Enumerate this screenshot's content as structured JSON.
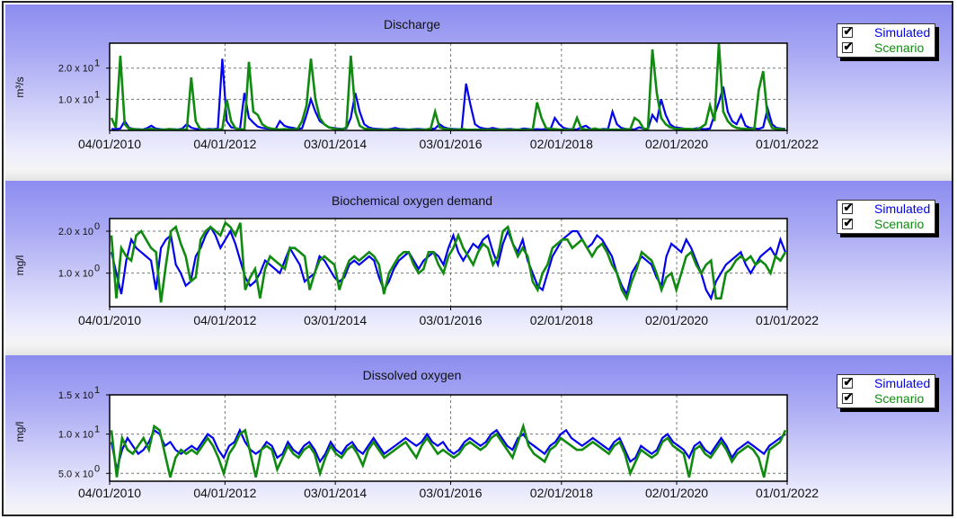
{
  "colors": {
    "simulated": "#0000ee",
    "scenario": "#108a10"
  },
  "legend": {
    "simulated_label": "Simulated",
    "scenario_label": "Scenario",
    "checked_glyph": "✔"
  },
  "chart_data": [
    {
      "type": "line",
      "title": "Discharge",
      "ylabel": "m³/s",
      "xlabel": "",
      "x_tick_labels": [
        "04/01/2010",
        "04/01/2012",
        "03/01/2014",
        "03/01/2016",
        "02/01/2018",
        "02/01/2020",
        "01/01/2022"
      ],
      "x_range": [
        "04/01/2010",
        "01/01/2022"
      ],
      "ylim": [
        0,
        28
      ],
      "y_ticks": [
        {
          "value": 20,
          "mantissa": "2.0",
          "exponent": "1"
        },
        {
          "value": 10,
          "mantissa": "1.0",
          "exponent": "1"
        }
      ],
      "grid": true,
      "series": [
        {
          "name": "Simulated",
          "values": [
            0.5,
            0.4,
            0.6,
            3,
            0.8,
            0.5,
            0.4,
            0.3,
            0.7,
            1.5,
            0.6,
            0.4,
            0.3,
            0.5,
            0.4,
            0.3,
            0.6,
            2,
            0.9,
            0.5,
            0.4,
            0.3,
            0.5,
            0.4,
            0.6,
            23,
            3,
            1,
            0.7,
            0.5,
            12,
            4,
            2.5,
            1.2,
            0.8,
            0.6,
            0.5,
            0.4,
            3,
            1.5,
            1,
            0.8,
            0.5,
            0.7,
            5,
            10,
            6,
            3,
            2,
            1,
            0.8,
            0.6,
            0.5,
            0.7,
            4,
            12,
            6,
            2,
            1,
            0.6,
            0.5,
            0.4,
            0.3,
            0.5,
            0.8,
            0.5,
            0.4,
            0.3,
            0.4,
            0.5,
            0.4,
            0.3,
            0.4,
            0.6,
            2,
            1,
            0.6,
            0.5,
            0.4,
            0.3,
            15,
            8,
            2,
            1,
            0.6,
            0.5,
            0.8,
            0.5,
            0.3,
            0.4,
            0.5,
            0.3,
            0.3,
            0.6,
            0.5,
            0.3,
            0.4,
            0.3,
            0.5,
            0.3,
            4,
            2,
            0.8,
            0.5,
            0.4,
            0.3,
            1,
            1.5,
            0.5,
            0.3,
            0.3,
            0.5,
            0.4,
            6,
            2,
            0.8,
            0.5,
            0.4,
            0.3,
            1,
            0.6,
            0.4,
            5,
            3,
            10,
            5,
            2,
            1,
            0.8,
            0.6,
            0.5,
            0.4,
            0.7,
            0.5,
            0.4,
            0.6,
            5,
            9,
            14,
            6,
            3,
            2,
            5,
            1.5,
            0.8,
            0.6,
            0.5,
            1,
            7,
            2,
            0.8,
            0.6,
            0.5
          ]
        },
        {
          "name": "Scenario",
          "values": [
            4,
            0.8,
            24,
            2,
            0.5,
            0.4,
            0.3,
            0.2,
            0.3,
            0.5,
            0.3,
            0.2,
            0.3,
            0.4,
            0.3,
            0.2,
            0.3,
            0.3,
            17,
            3,
            0.5,
            0.3,
            0.2,
            0.3,
            0.3,
            0.4,
            10,
            3,
            0.6,
            0.4,
            0.3,
            22,
            6,
            5,
            2,
            1,
            0.6,
            0.4,
            0.3,
            0.4,
            0.3,
            0.3,
            0.5,
            3,
            8,
            23,
            10,
            4,
            2,
            1,
            0.6,
            0.4,
            0.3,
            1,
            24,
            6,
            1.5,
            0.6,
            0.4,
            0.3,
            0.2,
            0.2,
            0.3,
            0.2,
            0.3,
            0.2,
            0.2,
            0.2,
            0.3,
            0.2,
            0.2,
            0.3,
            0.6,
            6,
            1,
            0.5,
            0.4,
            0.3,
            0.2,
            0.5,
            0.3,
            0.2,
            0.3,
            0.2,
            0.2,
            0.3,
            0.2,
            0.2,
            0.3,
            0.2,
            0.2,
            0.3,
            0.2,
            0.2,
            0.3,
            0.2,
            9,
            4,
            0.8,
            0.5,
            0.4,
            0.3,
            0.2,
            0.3,
            0.2,
            4,
            0.6,
            0.3,
            0.2,
            0.6,
            0.3,
            0.2,
            0.3,
            0.3,
            0.3,
            0.2,
            0.4,
            0.3,
            4,
            3,
            0.6,
            0.4,
            26,
            12,
            4,
            2,
            1,
            0.6,
            0.4,
            0.5,
            0.5,
            0.4,
            0.3,
            1,
            2,
            8,
            3,
            28,
            6,
            3,
            1.5,
            0.8,
            0.6,
            0.5,
            0.4,
            0.6,
            13,
            19,
            4,
            0.8,
            0.5,
            0.4,
            0.3
          ]
        }
      ]
    },
    {
      "type": "line",
      "title": "Biochemical oxygen demand",
      "ylabel": "mg/l",
      "xlabel": "",
      "x_tick_labels": [
        "04/01/2010",
        "04/01/2012",
        "03/01/2014",
        "03/01/2016",
        "02/01/2018",
        "02/01/2020",
        "01/01/2022"
      ],
      "x_range": [
        "04/01/2010",
        "01/01/2022"
      ],
      "ylim": [
        0.2,
        2.3
      ],
      "y_ticks": [
        {
          "value": 2.0,
          "mantissa": "2.0",
          "exponent": "0"
        },
        {
          "value": 1.0,
          "mantissa": "1.0",
          "exponent": "0"
        }
      ],
      "grid": true,
      "series": [
        {
          "name": "Simulated",
          "values": [
            1.5,
            1.0,
            0.5,
            1.3,
            1.8,
            1.6,
            1.5,
            1.4,
            1.3,
            0.6,
            1.6,
            1.8,
            1.9,
            1.2,
            1.0,
            0.7,
            0.8,
            1.4,
            1.6,
            1.9,
            2.1,
            1.9,
            1.6,
            1.8,
            2.0,
            1.7,
            1.3,
            0.9,
            0.7,
            0.8,
            1.0,
            1.3,
            1.2,
            1.1,
            1.0,
            1.3,
            1.6,
            1.4,
            1.2,
            0.8,
            0.9,
            1.0,
            1.4,
            1.3,
            1.1,
            0.9,
            0.8,
            0.9,
            1.2,
            1.3,
            1.2,
            1.3,
            1.4,
            1.3,
            0.9,
            0.6,
            0.8,
            1.1,
            1.3,
            1.4,
            1.5,
            1.3,
            1.1,
            1.3,
            1.4,
            1.5,
            1.4,
            1.2,
            1.6,
            1.9,
            1.5,
            1.3,
            1.5,
            1.7,
            1.6,
            1.8,
            1.9,
            1.5,
            1.2,
            1.7,
            2.0,
            1.7,
            1.5,
            1.8,
            1.3,
            1.0,
            0.7,
            0.6,
            1.0,
            1.4,
            1.6,
            1.8,
            1.9,
            2.0,
            2.0,
            1.8,
            1.6,
            1.7,
            1.9,
            1.8,
            1.6,
            1.4,
            1.0,
            0.7,
            0.5,
            1.0,
            1.2,
            1.4,
            1.3,
            1.2,
            0.9,
            0.7,
            1.4,
            1.7,
            1.6,
            1.5,
            1.8,
            1.6,
            1.3,
            1.0,
            0.6,
            0.4,
            0.8,
            1.0,
            1.2,
            1.3,
            1.4,
            1.5,
            1.2,
            1.0,
            1.2,
            1.4,
            1.5,
            1.6,
            1.4,
            1.8,
            1.5
          ]
        },
        {
          "name": "Scenario",
          "values": [
            1.9,
            0.4,
            1.6,
            1.4,
            1.3,
            1.9,
            2.0,
            1.8,
            1.6,
            1.5,
            0.3,
            1.2,
            2.0,
            2.1,
            1.7,
            1.4,
            0.8,
            0.9,
            1.8,
            2.0,
            2.1,
            2.0,
            1.9,
            2.2,
            2.1,
            1.9,
            2.2,
            0.6,
            0.9,
            1.1,
            0.4,
            1.1,
            1.4,
            1.3,
            1.2,
            1.1,
            1.6,
            1.6,
            1.5,
            1.4,
            0.6,
            1.0,
            1.3,
            1.4,
            1.3,
            1.2,
            0.6,
            1.0,
            1.3,
            1.4,
            1.3,
            1.4,
            1.5,
            1.4,
            1.2,
            0.5,
            1.0,
            1.2,
            1.4,
            1.5,
            1.5,
            1.2,
            1.0,
            1.1,
            1.5,
            1.5,
            1.2,
            1.0,
            1.4,
            1.6,
            1.9,
            1.6,
            1.4,
            1.2,
            1.5,
            1.7,
            1.6,
            1.2,
            1.4,
            2.0,
            2.1,
            1.7,
            1.4,
            1.6,
            1.4,
            0.8,
            0.6,
            1.0,
            1.2,
            1.6,
            1.7,
            1.8,
            1.8,
            1.6,
            1.7,
            1.8,
            1.6,
            1.4,
            1.6,
            1.7,
            1.5,
            1.2,
            1.0,
            0.6,
            0.4,
            0.8,
            1.1,
            1.5,
            1.4,
            1.3,
            1.0,
            0.6,
            0.9,
            1.0,
            0.6,
            1.0,
            1.4,
            1.5,
            1.2,
            1.0,
            1.2,
            1.3,
            0.4,
            0.4,
            1.0,
            1.1,
            1.3,
            1.4,
            1.3,
            1.4,
            1.2,
            1.3,
            1.2,
            1.0,
            1.4,
            1.3,
            1.5
          ]
        }
      ]
    },
    {
      "type": "line",
      "title": "Dissolved oxygen",
      "ylabel": "mg/l",
      "xlabel": "",
      "x_tick_labels": [
        "04/01/2010",
        "04/01/2012",
        "03/01/2014",
        "03/01/2016",
        "02/01/2018",
        "02/01/2020",
        "01/01/2022"
      ],
      "x_range": [
        "04/01/2010",
        "01/01/2022"
      ],
      "ylim": [
        4.0,
        15.0
      ],
      "y_ticks": [
        {
          "value": 15,
          "mantissa": "1.5",
          "exponent": "1"
        },
        {
          "value": 10,
          "mantissa": "1.0",
          "exponent": "1"
        },
        {
          "value": 5,
          "mantissa": "5.0",
          "exponent": "0"
        }
      ],
      "grid": true,
      "series": [
        {
          "name": "Simulated",
          "values": [
            9.0,
            5.5,
            8.0,
            9.5,
            8.5,
            7.5,
            8.0,
            9.0,
            10.5,
            10.0,
            8.5,
            9.0,
            8.0,
            7.5,
            8.0,
            8.5,
            8.0,
            9.0,
            10.0,
            9.5,
            8.0,
            7.0,
            8.5,
            9.0,
            10.5,
            9.0,
            8.0,
            7.5,
            8.0,
            9.0,
            8.5,
            7.0,
            7.5,
            9.0,
            8.0,
            7.5,
            8.5,
            9.0,
            8.0,
            6.5,
            7.5,
            9.0,
            8.0,
            7.5,
            8.5,
            9.0,
            8.0,
            7.5,
            8.5,
            9.5,
            8.5,
            7.5,
            8.0,
            8.5,
            9.0,
            9.5,
            9.0,
            8.5,
            9.0,
            10.0,
            9.0,
            8.5,
            9.0,
            8.0,
            7.5,
            8.0,
            9.0,
            9.5,
            9.0,
            8.5,
            9.0,
            10.0,
            10.5,
            9.5,
            8.5,
            8.0,
            9.5,
            10.0,
            9.0,
            8.5,
            8.0,
            7.5,
            8.5,
            9.0,
            10.0,
            10.5,
            9.5,
            9.0,
            8.5,
            9.0,
            9.5,
            9.0,
            8.5,
            8.0,
            9.0,
            9.5,
            8.0,
            6.5,
            7.0,
            8.5,
            8.0,
            7.5,
            8.0,
            9.5,
            10.0,
            9.0,
            8.5,
            8.0,
            7.0,
            8.5,
            9.0,
            8.0,
            7.5,
            8.5,
            9.5,
            8.5,
            7.0,
            8.0,
            8.5,
            9.0,
            8.5,
            8.0,
            7.5,
            8.5,
            9.0,
            9.5,
            10.0
          ]
        },
        {
          "name": "Scenario",
          "values": [
            10.5,
            4.5,
            9.5,
            8.0,
            7.5,
            8.5,
            9.5,
            8.0,
            11.0,
            10.5,
            7.5,
            4.5,
            7.0,
            8.0,
            7.5,
            8.0,
            7.5,
            8.5,
            9.5,
            8.5,
            7.0,
            5.0,
            7.5,
            8.5,
            10.0,
            10.5,
            7.5,
            4.5,
            8.0,
            8.5,
            8.0,
            5.5,
            7.0,
            8.5,
            7.5,
            7.0,
            8.0,
            8.5,
            7.5,
            5.0,
            7.0,
            8.5,
            7.5,
            7.0,
            8.0,
            8.5,
            7.5,
            6.0,
            8.0,
            9.0,
            8.0,
            7.0,
            7.5,
            8.0,
            8.5,
            9.0,
            8.0,
            7.0,
            8.5,
            9.5,
            8.5,
            7.5,
            8.0,
            7.5,
            7.0,
            7.5,
            8.5,
            9.0,
            8.5,
            8.0,
            8.5,
            9.5,
            10.0,
            9.0,
            8.0,
            7.0,
            9.0,
            11.0,
            8.5,
            7.5,
            7.0,
            6.5,
            8.0,
            8.5,
            9.5,
            9.0,
            8.5,
            8.0,
            8.0,
            8.5,
            9.0,
            8.5,
            8.0,
            7.5,
            8.5,
            9.0,
            7.5,
            5.0,
            6.5,
            8.0,
            7.5,
            7.0,
            7.5,
            9.0,
            9.5,
            8.5,
            8.0,
            7.5,
            4.5,
            8.0,
            8.5,
            7.5,
            7.0,
            8.0,
            9.0,
            8.0,
            6.5,
            7.5,
            8.0,
            8.5,
            8.0,
            7.0,
            4.5,
            8.0,
            8.5,
            9.0,
            10.5
          ]
        }
      ]
    }
  ]
}
